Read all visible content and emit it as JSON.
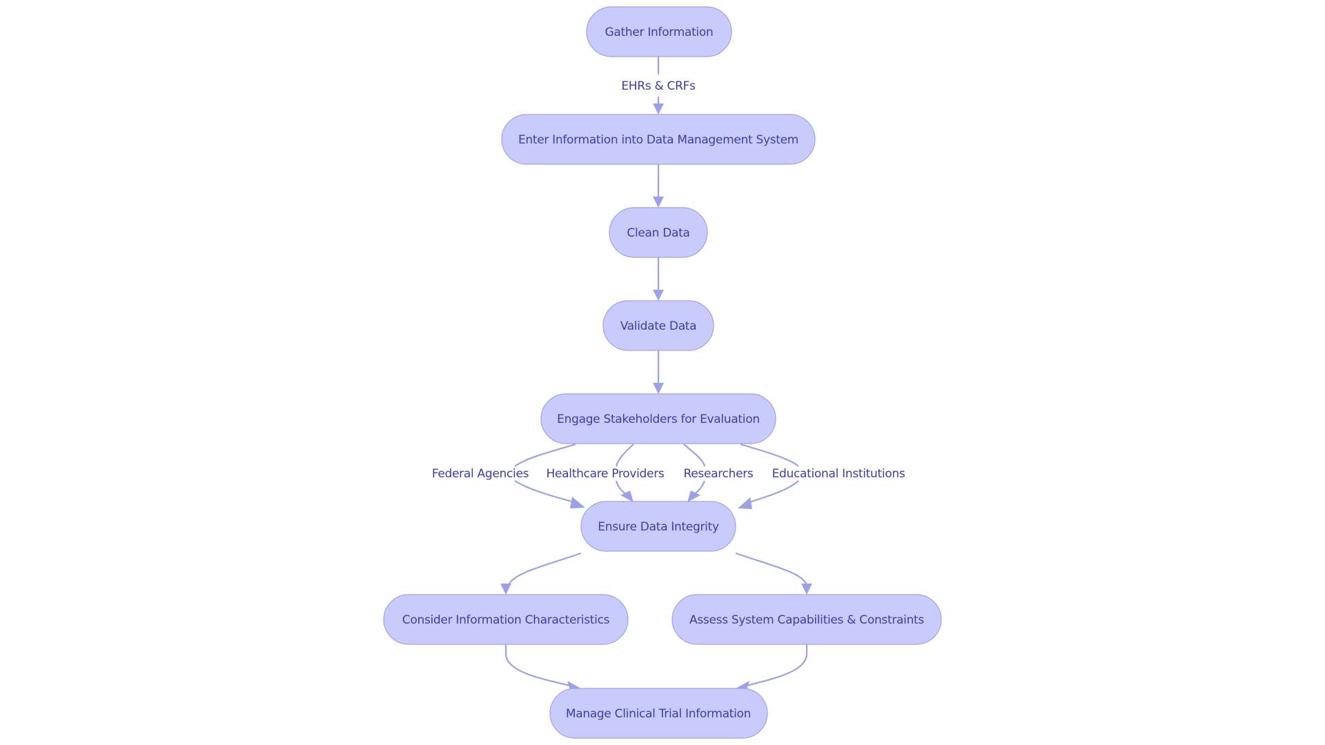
{
  "diagram": {
    "type": "flowchart",
    "direction": "top-down",
    "colors": {
      "node_fill": "#c9ccfb",
      "node_border": "#9ea2ea",
      "edge": "#9ba0e9",
      "text": "#3b3da8",
      "background": "#ffffff"
    },
    "nodes": [
      {
        "id": "gather",
        "label": "Gather Information"
      },
      {
        "id": "enter",
        "label": "Enter Information into Data Management System"
      },
      {
        "id": "clean",
        "label": "Clean Data"
      },
      {
        "id": "validate",
        "label": "Validate Data"
      },
      {
        "id": "engage",
        "label": "Engage Stakeholders for Evaluation"
      },
      {
        "id": "ensure",
        "label": "Ensure Data Integrity"
      },
      {
        "id": "consider",
        "label": "Consider Information Characteristics"
      },
      {
        "id": "assess",
        "label": "Assess System Capabilities & Constraints"
      },
      {
        "id": "manage",
        "label": "Manage Clinical Trial Information"
      }
    ],
    "edges": [
      {
        "from": "gather",
        "to": "enter",
        "label": "EHRs & CRFs"
      },
      {
        "from": "enter",
        "to": "clean",
        "label": ""
      },
      {
        "from": "clean",
        "to": "validate",
        "label": ""
      },
      {
        "from": "validate",
        "to": "engage",
        "label": ""
      },
      {
        "from": "engage",
        "to": "ensure",
        "label": "Federal Agencies"
      },
      {
        "from": "engage",
        "to": "ensure",
        "label": "Healthcare Providers"
      },
      {
        "from": "engage",
        "to": "ensure",
        "label": "Researchers"
      },
      {
        "from": "engage",
        "to": "ensure",
        "label": "Educational Institutions"
      },
      {
        "from": "ensure",
        "to": "consider",
        "label": ""
      },
      {
        "from": "ensure",
        "to": "assess",
        "label": ""
      },
      {
        "from": "consider",
        "to": "manage",
        "label": ""
      },
      {
        "from": "assess",
        "to": "manage",
        "label": ""
      }
    ]
  }
}
